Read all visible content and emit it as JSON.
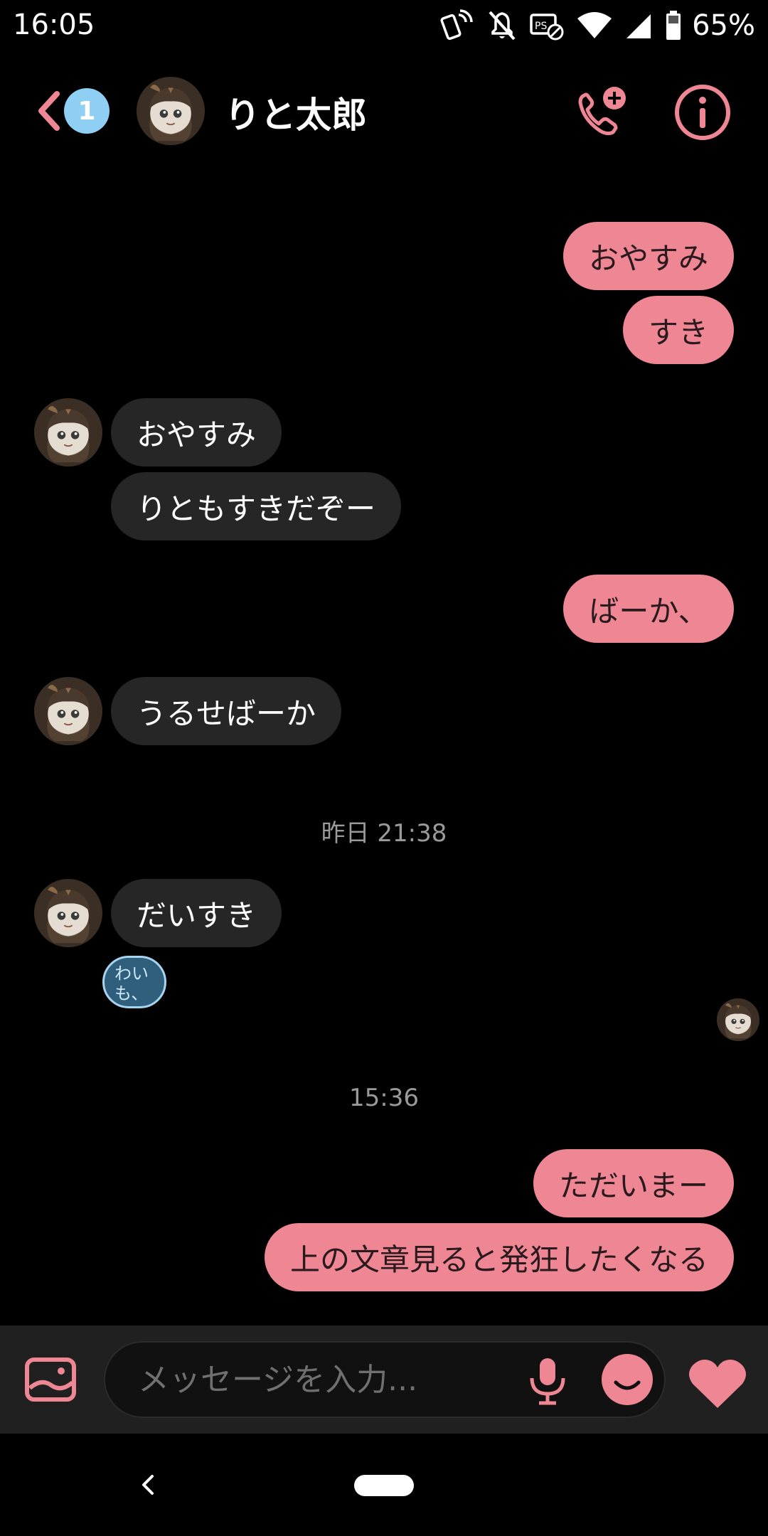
{
  "status_bar": {
    "time": "16:05",
    "battery_percent": "65%",
    "icons": [
      "nfc-phone-icon",
      "notifications-off-icon",
      "screen-record-icon",
      "wifi-icon",
      "signal-icon",
      "battery-icon"
    ]
  },
  "header": {
    "unread_count": "1",
    "contact_name": "りと太郎",
    "icons": [
      "back-chevron-icon",
      "add-call-icon",
      "info-icon"
    ]
  },
  "messages": [
    {
      "side": "out",
      "text": "おやすみ"
    },
    {
      "side": "out",
      "text": "すき"
    },
    {
      "side": "in",
      "text": "おやすみ"
    },
    {
      "side": "in",
      "text": "りともすきだぞー"
    },
    {
      "side": "out",
      "text": "ばーか、"
    },
    {
      "side": "in",
      "text": "うるせばーか"
    },
    {
      "side": "in",
      "text": "だいすき"
    },
    {
      "side": "out",
      "text": "ただいまー"
    },
    {
      "side": "out",
      "text": "上の文章見ると発狂したくなる"
    }
  ],
  "timestamps": [
    "昨日 21:38",
    "15:36"
  ],
  "reaction": {
    "line1": "わい",
    "line2": "も、"
  },
  "composer": {
    "placeholder": "メッセージを入力...",
    "icons": [
      "image-icon",
      "mic-icon",
      "emoji-icon",
      "heart-icon"
    ]
  },
  "colors": {
    "accent_pink": "#ee8694",
    "incoming_bubble": "#262626",
    "badge_blue": "#8ecff3",
    "background": "#000000"
  }
}
